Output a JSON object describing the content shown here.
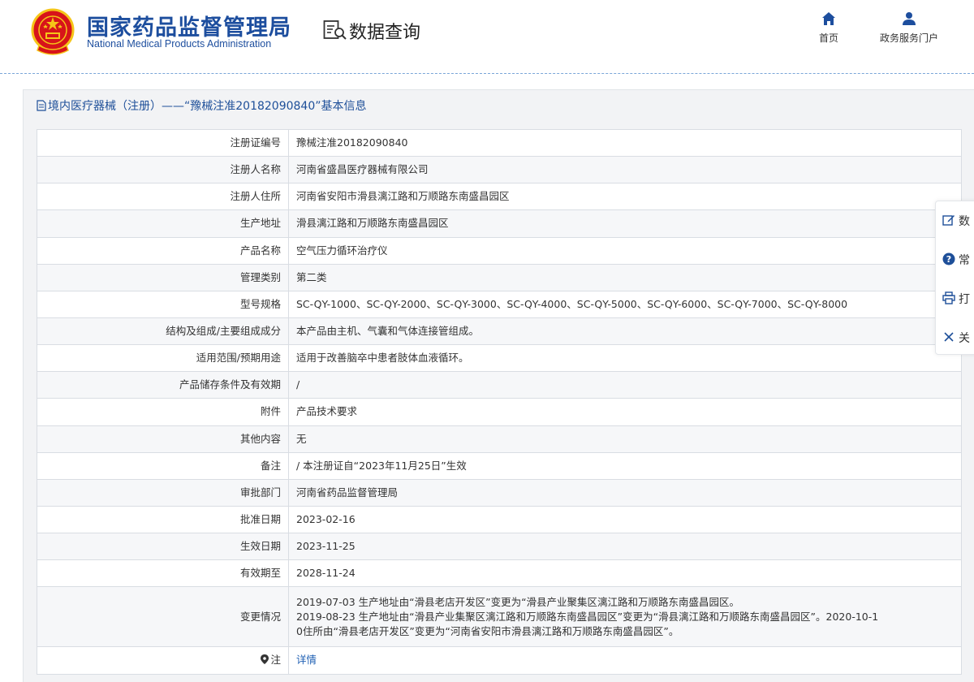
{
  "header": {
    "logo_cn": "国家药品监督管理局",
    "logo_en": "National Medical Products Administration",
    "query_title": "数据查询",
    "nav": [
      {
        "label": "首页",
        "icon": "home-icon"
      },
      {
        "label": "政务服务门户",
        "icon": "user-icon"
      }
    ]
  },
  "panel": {
    "title": "境内医疗器械（注册）——“豫械注准20182090840”基本信息"
  },
  "rows": [
    {
      "label": "注册证编号",
      "value": "豫械注准20182090840"
    },
    {
      "label": "注册人名称",
      "value": "河南省盛昌医疗器械有限公司"
    },
    {
      "label": "注册人住所",
      "value": "河南省安阳市滑县漓江路和万顺路东南盛昌园区"
    },
    {
      "label": "生产地址",
      "value": "滑县漓江路和万顺路东南盛昌园区"
    },
    {
      "label": "产品名称",
      "value": "空气压力循环治疗仪"
    },
    {
      "label": "管理类别",
      "value": "第二类"
    },
    {
      "label": "型号规格",
      "value": "SC-QY-1000、SC-QY-2000、SC-QY-3000、SC-QY-4000、SC-QY-5000、SC-QY-6000、SC-QY-7000、SC-QY-8000"
    },
    {
      "label": "结构及组成/主要组成成分",
      "value": "本产品由主机、气囊和气体连接管组成。"
    },
    {
      "label": "适用范围/预期用途",
      "value": "适用于改善脑卒中患者肢体血液循环。"
    },
    {
      "label": "产品储存条件及有效期",
      "value": "/"
    },
    {
      "label": "附件",
      "value": "产品技术要求"
    },
    {
      "label": "其他内容",
      "value": "无"
    },
    {
      "label": "备注",
      "value": "/ 本注册证自“2023年11月25日”生效"
    },
    {
      "label": "审批部门",
      "value": "河南省药品监督管理局"
    },
    {
      "label": "批准日期",
      "value": "2023-02-16"
    },
    {
      "label": "生效日期",
      "value": "2023-11-25"
    },
    {
      "label": "有效期至",
      "value": "2028-11-24"
    },
    {
      "label": "变更情况",
      "value_lines": [
        "2019-07-03 生产地址由“滑县老店开发区”变更为“滑县产业聚集区漓江路和万顺路东南盛昌园区。",
        "2019-08-23 生产地址由“滑县产业集聚区漓江路和万顺路东南盛昌园区”变更为“滑县漓江路和万顺路东南盛昌园区”。2020-10-1",
        "0住所由“滑县老店开发区”变更为“河南省安阳市滑县漓江路和万顺路东南盛昌园区”。"
      ]
    },
    {
      "label": "注",
      "value": "详情"
    }
  ],
  "sidebar": {
    "items": [
      {
        "label": "数",
        "icon": "edit-icon"
      },
      {
        "label": "常",
        "icon": "question-icon"
      },
      {
        "label": "打",
        "icon": "print-icon"
      },
      {
        "label": "关",
        "icon": "close-icon"
      }
    ]
  },
  "colors": {
    "brand_blue": "#1d4e9e",
    "link_blue": "#1e5fb3",
    "emblem_red": "#d7141a",
    "emblem_gold": "#f5c518"
  }
}
